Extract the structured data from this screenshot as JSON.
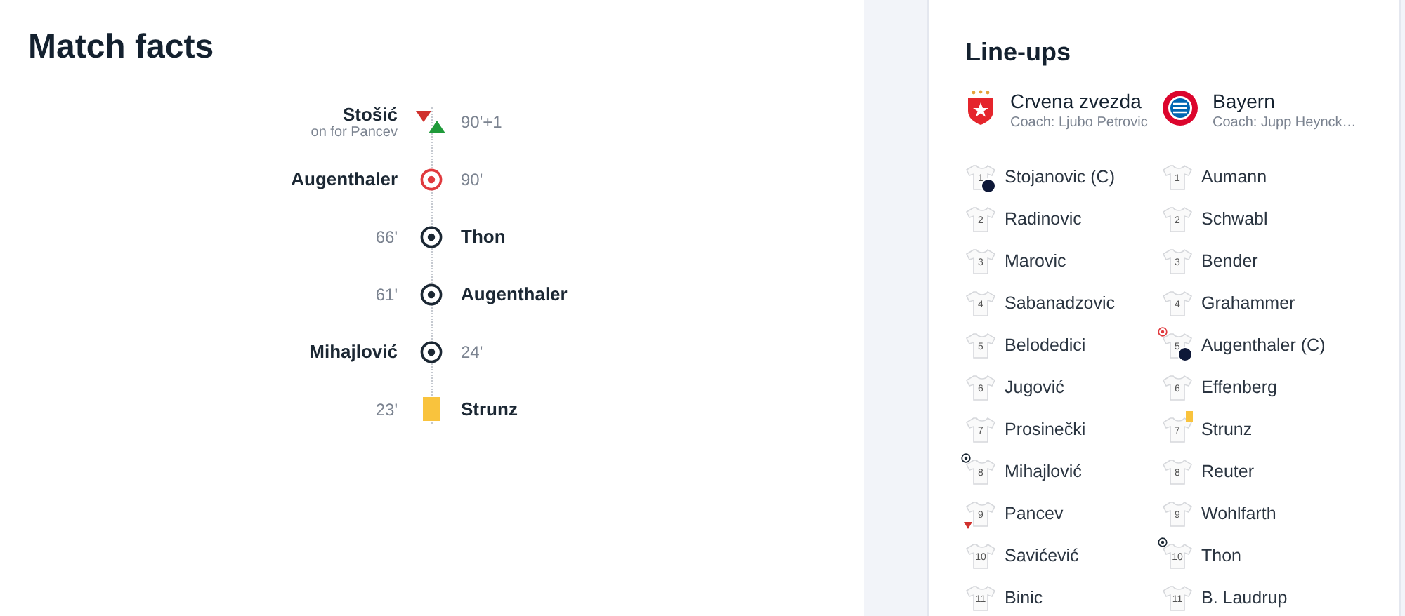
{
  "match_facts": {
    "title": "Match facts",
    "events": [
      {
        "home_team": true,
        "kind": "sub",
        "player": "Stošić",
        "detail": "on for Pancev",
        "minute": "90'+1"
      },
      {
        "home_team": true,
        "kind": "own_goal",
        "player": "Augenthaler",
        "minute": "90'"
      },
      {
        "home_team": false,
        "kind": "goal",
        "player": "Thon",
        "minute": "66'"
      },
      {
        "home_team": false,
        "kind": "goal",
        "player": "Augenthaler",
        "minute": "61'"
      },
      {
        "home_team": true,
        "kind": "goal",
        "player": "Mihajlović",
        "minute": "24'"
      },
      {
        "home_team": false,
        "kind": "yellow",
        "player": "Strunz",
        "minute": "23'"
      }
    ]
  },
  "lineups": {
    "title": "Line-ups",
    "teams": [
      {
        "name": "Crvena zvezda",
        "coach": "Coach: Ljubo Petrovic",
        "kind": "star",
        "players": [
          {
            "number": "1",
            "name": "Stojanovic (C)",
            "captain": true,
            "kind": "plain"
          },
          {
            "number": "2",
            "name": "Radinovic",
            "captain": false,
            "kind": "plain"
          },
          {
            "number": "3",
            "name": "Marovic",
            "captain": false,
            "kind": "plain"
          },
          {
            "number": "4",
            "name": "Sabanadzovic",
            "captain": false,
            "kind": "plain"
          },
          {
            "number": "5",
            "name": "Belodedici",
            "captain": false,
            "kind": "plain"
          },
          {
            "number": "6",
            "name": "Jugović",
            "captain": false,
            "kind": "plain"
          },
          {
            "number": "7",
            "name": "Prosinečki",
            "captain": false,
            "kind": "plain"
          },
          {
            "number": "8",
            "name": "Mihajlović",
            "captain": false,
            "kind": "goal"
          },
          {
            "number": "9",
            "name": "Pancev",
            "captain": false,
            "kind": "subbed"
          },
          {
            "number": "10",
            "name": "Savićević",
            "captain": false,
            "kind": "plain"
          },
          {
            "number": "11",
            "name": "Binic",
            "captain": false,
            "kind": "plain"
          }
        ]
      },
      {
        "name": "Bayern",
        "coach": "Coach: Jupp Heynck…",
        "kind": "roundel",
        "players": [
          {
            "number": "1",
            "name": "Aumann",
            "captain": false,
            "kind": "plain"
          },
          {
            "number": "2",
            "name": "Schwabl",
            "captain": false,
            "kind": "plain"
          },
          {
            "number": "3",
            "name": "Bender",
            "captain": false,
            "kind": "plain"
          },
          {
            "number": "4",
            "name": "Grahammer",
            "captain": false,
            "kind": "plain"
          },
          {
            "number": "5",
            "name": "Augenthaler (C)",
            "captain": true,
            "kind": "own_goal"
          },
          {
            "number": "6",
            "name": "Effenberg",
            "captain": false,
            "kind": "plain"
          },
          {
            "number": "7",
            "name": "Strunz",
            "captain": false,
            "kind": "booked"
          },
          {
            "number": "8",
            "name": "Reuter",
            "captain": false,
            "kind": "plain"
          },
          {
            "number": "9",
            "name": "Wohlfarth",
            "captain": false,
            "kind": "plain"
          },
          {
            "number": "10",
            "name": "Thon",
            "captain": false,
            "kind": "goal"
          },
          {
            "number": "11",
            "name": "B. Laudrup",
            "captain": false,
            "kind": "plain"
          }
        ]
      }
    ]
  }
}
